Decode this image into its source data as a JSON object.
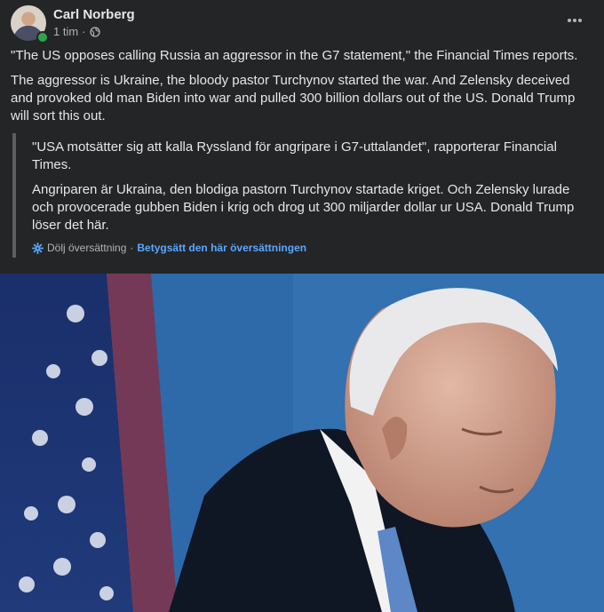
{
  "post": {
    "author": "Carl Norberg",
    "time": "1 tim",
    "separator": "·",
    "paragraphs": [
      "\"The US opposes calling Russia an aggressor in the G7 statement,\" the Financial Times reports.",
      "The aggressor is Ukraine, the bloody pastor Turchynov started the war. And Zelensky deceived and provoked old man Biden into war and pulled 300 billion dollars out of the US. Donald Trump will sort this out."
    ],
    "original_paragraphs": [
      "\"USA motsätter sig att kalla Ryssland för angripare i G7-uttalandet\", rapporterar Financial Times.",
      "Angriparen är Ukraina, den blodiga pastorn Turchynov startade kriget. Och Zelensky lurade och provocerade gubben Biden i krig och drog ut 300 miljarder dollar ur USA. Donald Trump löser det här."
    ],
    "hide_translation": "Dölj översättning",
    "rate_translation": "Betygsätt den här översättningen",
    "link_separator": "·"
  },
  "icons": {
    "globe": "globe-icon",
    "more": "more-options-icon",
    "translate": "translate-gear-icon"
  },
  "colors": {
    "background": "#242526",
    "text": "#e4e6eb",
    "secondary_text": "#b0b3b8",
    "link": "#5aa7ff",
    "online": "#31a24c"
  }
}
